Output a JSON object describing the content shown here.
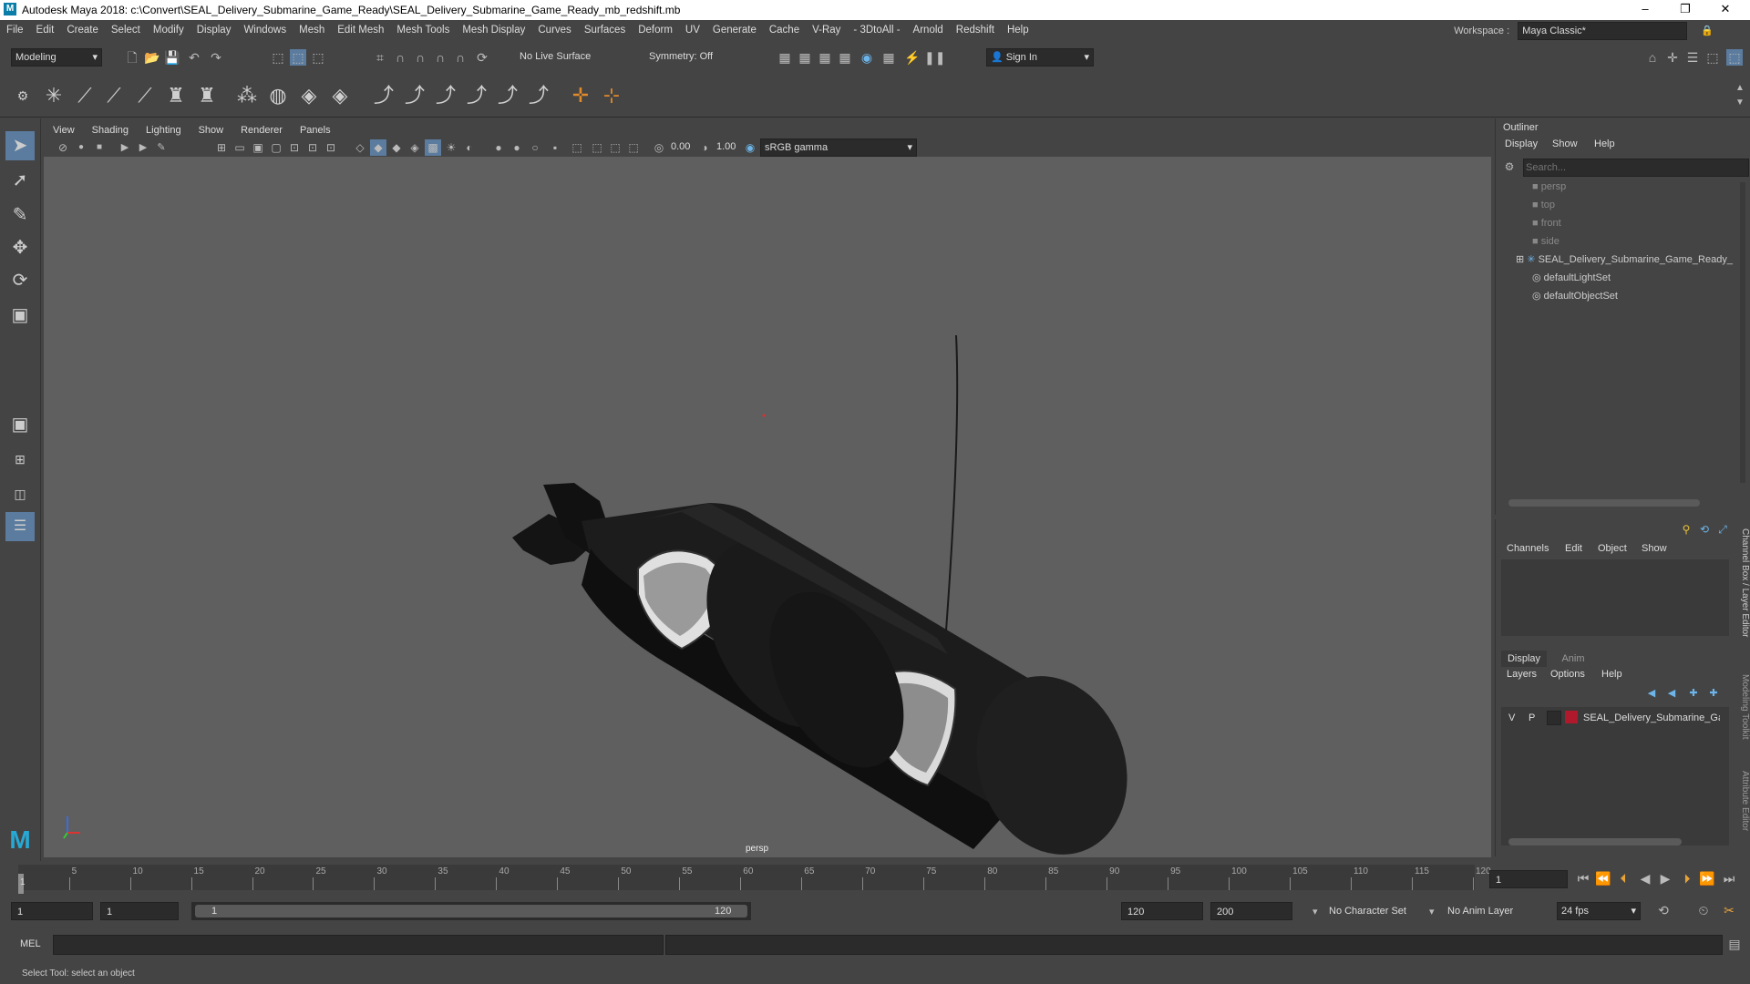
{
  "window": {
    "title": "Autodesk Maya 2018: c:\\Convert\\SEAL_Delivery_Submarine_Game_Ready\\SEAL_Delivery_Submarine_Game_Ready_mb_redshift.mb",
    "logo": "M",
    "minimize": "–",
    "maximize": "❐",
    "close": "✕"
  },
  "menubar": {
    "items": [
      "File",
      "Edit",
      "Create",
      "Select",
      "Modify",
      "Display",
      "Windows",
      "Mesh",
      "Edit Mesh",
      "Mesh Tools",
      "Mesh Display",
      "Curves",
      "Surfaces",
      "Deform",
      "UV",
      "Generate",
      "Cache",
      "V-Ray",
      "- 3DtoAll -",
      "Arnold",
      "Redshift",
      "Help"
    ],
    "workspace_label": "Workspace :",
    "workspace_value": "Maya Classic*"
  },
  "statusline": {
    "mode": "Modeling",
    "live_surface": "No Live Surface",
    "symmetry": "Symmetry: Off",
    "sign_in": "Sign In"
  },
  "viewport": {
    "menus": [
      "View",
      "Shading",
      "Lighting",
      "Show",
      "Renderer",
      "Panels"
    ],
    "exposure": "0.00",
    "gamma": "1.00",
    "color_space": "sRGB gamma",
    "camera_label": "persp"
  },
  "outliner": {
    "title": "Outliner",
    "menus": [
      "Display",
      "Show",
      "Help"
    ],
    "search_placeholder": "Search...",
    "items": [
      "persp",
      "top",
      "front",
      "side",
      "SEAL_Delivery_Submarine_Game_Ready_",
      "defaultLightSet",
      "defaultObjectSet"
    ]
  },
  "channelbox": {
    "menus": [
      "Channels",
      "Edit",
      "Object",
      "Show"
    ],
    "tabs": [
      "Display",
      "Anim"
    ],
    "layer_menus": [
      "Layers",
      "Options",
      "Help"
    ],
    "layer": {
      "v": "V",
      "p": "P",
      "name": "SEAL_Delivery_Submarine_Gam",
      "color": "#b0182c"
    },
    "side_tabs": [
      "Channel Box / Layer Editor",
      "Modeling Toolkit",
      "Attribute Editor"
    ]
  },
  "timeline": {
    "ticks": [
      "5",
      "10",
      "15",
      "20",
      "25",
      "30",
      "35",
      "40",
      "45",
      "50",
      "55",
      "60",
      "65",
      "70",
      "75",
      "80",
      "85",
      "90",
      "95",
      "100",
      "105",
      "110",
      "115",
      "120"
    ],
    "start_marker": "1",
    "current_frame": "1"
  },
  "rangebar": {
    "start": "1",
    "playback_start": "1",
    "slider_start": "1",
    "slider_end": "120",
    "playback_end": "120",
    "end": "200",
    "character_set": "No Character Set",
    "anim_layer": "No Anim Layer",
    "fps": "24 fps"
  },
  "cmdline": {
    "label": "MEL"
  },
  "helpline": {
    "text": "Select Tool: select an object"
  }
}
